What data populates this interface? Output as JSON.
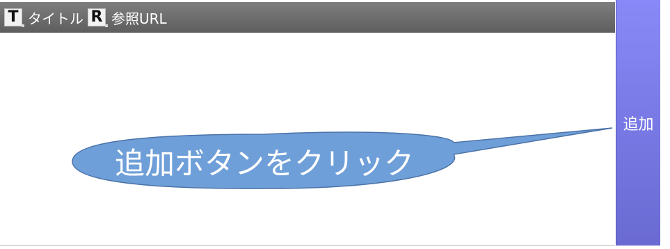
{
  "toolbar": {
    "title_icon": "T",
    "title_label": "タイトル",
    "reference_icon": "R",
    "reference_label": "参照URL"
  },
  "add_button": {
    "label": "追加"
  },
  "callout": {
    "text": "追加ボタンをクリック",
    "fill": "#6f9fd8",
    "stroke": "#4a72a8"
  },
  "colors": {
    "toolbar": "#6e6e6e",
    "button": "#7b7be8"
  }
}
